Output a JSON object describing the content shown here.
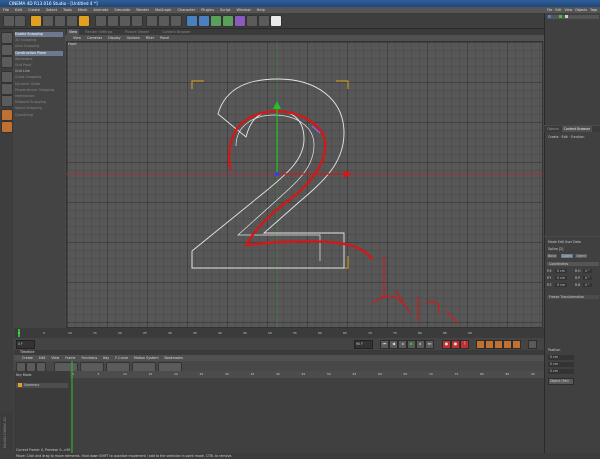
{
  "window": {
    "title": "CINEMA 4D R13.016 Studio - [Untitled 4 *]"
  },
  "menu": [
    "File",
    "Edit",
    "Create",
    "Select",
    "Tools",
    "Mesh",
    "Animate",
    "Simulate",
    "Render",
    "MoGraph",
    "Character",
    "Plugins",
    "Script",
    "Window",
    "Help"
  ],
  "right_panel_menu": [
    "File",
    "Edit",
    "View",
    "Objects",
    "Tags",
    "Bookmarks"
  ],
  "snapping_panel": {
    "items": [
      {
        "label": "Enable Snapping",
        "style": "hdr"
      },
      {
        "label": "3D Snapping",
        "style": "dim"
      },
      {
        "label": "Auto Snapping",
        "style": "dim"
      },
      {
        "label": "Construction Plane",
        "style": "hdr"
      },
      {
        "label": "Workplane",
        "style": "dim"
      },
      {
        "label": "Grid Point",
        "style": "dim"
      },
      {
        "label": "Grid Line",
        "style": "normal"
      },
      {
        "label": "Guide Snapping",
        "style": "dim"
      },
      {
        "label": "Dynamic Guide",
        "style": "dim"
      },
      {
        "label": "Perpendicular Snapping",
        "style": "dim"
      },
      {
        "label": "Intersection",
        "style": "dim"
      },
      {
        "label": "Midpoint Snapping",
        "style": "dim"
      },
      {
        "label": "Spline Snapping",
        "style": "dim"
      },
      {
        "label": "Quantizing",
        "style": "dim"
      }
    ]
  },
  "viewport": {
    "tabs": [
      "View",
      "Render Settings",
      "Picture Viewer",
      "Content Browser"
    ],
    "menu": [
      "View",
      "Cameras",
      "Display",
      "Options",
      "Filter",
      "Panel"
    ],
    "label": "Front"
  },
  "timeline_ruler": {
    "ticks": [
      "0",
      "5",
      "10",
      "15",
      "20",
      "25",
      "30",
      "35",
      "40",
      "45",
      "50",
      "55",
      "60",
      "65",
      "70",
      "75",
      "80",
      "85",
      "90"
    ],
    "current_frame": "0 F"
  },
  "anim": {
    "start": "0 F",
    "end": "90 F"
  },
  "timeline": {
    "title": "Timeline",
    "menu": [
      "Create",
      "Edit",
      "View",
      "Frame",
      "Functions",
      "Key",
      "F-Curve",
      "Motion System",
      "Bookmarks"
    ],
    "left_header": "Key Mode",
    "object": "Summary",
    "ruler": [
      "0",
      "5",
      "10",
      "15",
      "20",
      "25",
      "30",
      "35",
      "40",
      "45",
      "50",
      "55",
      "60",
      "65",
      "70",
      "75",
      "80",
      "85",
      "90"
    ]
  },
  "right_tabs": [
    "Objects",
    "Content Browser",
    "Structure"
  ],
  "attributes": {
    "menu": [
      "Mode",
      "Edit",
      "User Data"
    ],
    "title": "Spline [2]",
    "tabs": [
      "Basic",
      "Coord.",
      "Object"
    ],
    "section": "Coordinates",
    "rows": [
      {
        "axis": "P.X",
        "value": "0 cm",
        "rot": "R.H",
        "rval": "0 °"
      },
      {
        "axis": "P.Y",
        "value": "0 cm",
        "rot": "R.P",
        "rval": "0 °"
      },
      {
        "axis": "P.Z",
        "value": "0 cm",
        "rot": "R.B",
        "rval": "0 °"
      }
    ],
    "freeze": "Freeze Transformation"
  },
  "coordinates": {
    "title": "Position",
    "rows": [
      "0 cm",
      "0 cm",
      "0 cm"
    ],
    "button": "Object (Rel)"
  },
  "status": "Move: Click and drag to move elements. Hold down SHIFT to quantize movement / add to the selection in point mode, CTRL to remove.",
  "timeline_status": "Current Frame: 0, Preview: 0-->90",
  "brand": "MAXON CINEMA 4D",
  "colors": {
    "spline": "#e6e6e6",
    "annotation": "#d01a1a",
    "axis_y": "#22c422",
    "bracket": "#e0a020"
  }
}
